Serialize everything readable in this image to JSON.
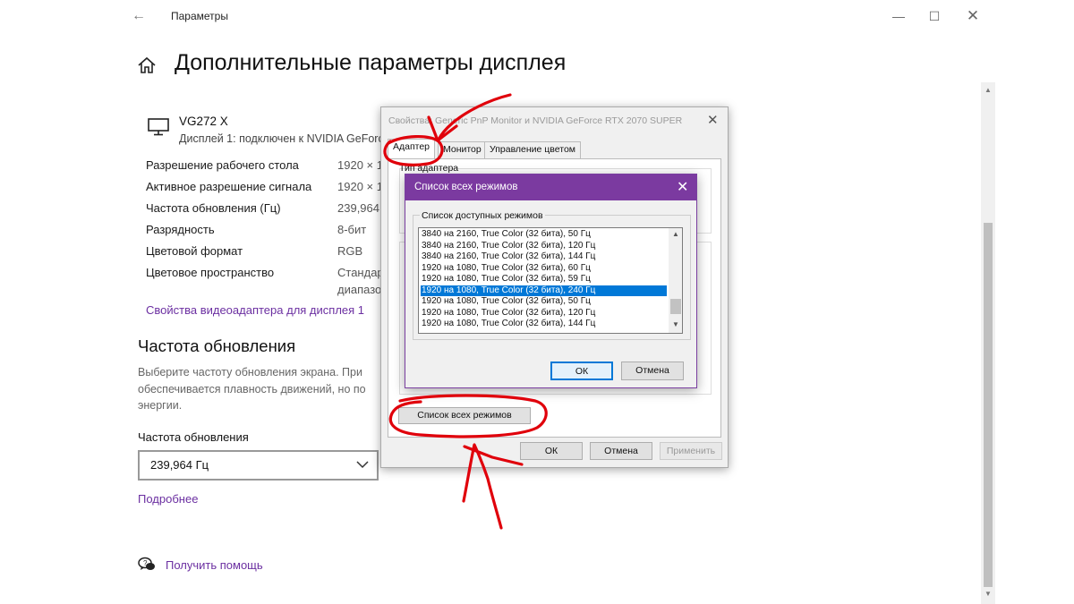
{
  "settings": {
    "window_title": "Параметры",
    "page_title": "Дополнительные параметры дисплея",
    "monitor": {
      "name": "VG272 X",
      "subtitle": "Дисплей 1: подключен к NVIDIA GeForce"
    },
    "info_rows": [
      {
        "label": "Разрешение рабочего стола",
        "value": "1920 × 1"
      },
      {
        "label": "Активное разрешение сигнала",
        "value": "1920 × 1"
      },
      {
        "label": "Частота обновления (Гц)",
        "value": "239,964"
      },
      {
        "label": "Разрядность",
        "value": "8-бит"
      },
      {
        "label": "Цветовой формат",
        "value": "RGB"
      },
      {
        "label": "Цветовое пространство",
        "value": "Стандар",
        "value2": "диапазо"
      }
    ],
    "adapter_link": "Свойства видеоадаптера для дисплея 1",
    "refresh_section_title": "Частота обновления",
    "refresh_desc_1": "Выберите частоту обновления экрана. При",
    "refresh_desc_2": "обеспечивается плавность движений, но по",
    "refresh_desc_3": "энергии.",
    "refresh_label": "Частота обновления",
    "refresh_value": "239,964 Гц",
    "more_link": "Подробнее",
    "help_link": "Получить помощь"
  },
  "properties_dialog": {
    "title": "Свойства: Generic PnP Monitor и NVIDIA GeForce RTX 2070 SUPER",
    "tabs": [
      "Адаптер",
      "Монитор",
      "Управление цветом"
    ],
    "adapter_type_label": "Тип адаптера",
    "all_modes_button": "Список всех режимов",
    "ok": "ОК",
    "cancel": "Отмена",
    "apply": "Применить"
  },
  "modes_dialog": {
    "title": "Список всех режимов",
    "group_label": "Список доступных режимов",
    "modes": [
      "3840 на 2160, True Color (32 бита), 50 Гц",
      "3840 на 2160, True Color (32 бита), 120 Гц",
      "3840 на 2160, True Color (32 бита), 144 Гц",
      "1920 на 1080, True Color (32 бита), 60 Гц",
      "1920 на 1080, True Color (32 бита), 59 Гц",
      "1920 на 1080, True Color (32 бита), 240 Гц",
      "1920 на 1080, True Color (32 бита), 50 Гц",
      "1920 на 1080, True Color (32 бита), 120 Гц",
      "1920 на 1080, True Color (32 бита), 144 Гц"
    ],
    "selected_index": 5,
    "ok": "ОК",
    "cancel": "Отмена"
  },
  "colors": {
    "accent_purple": "#7b3aa0",
    "link_purple": "#6b2fa1",
    "selection_blue": "#0078d7",
    "annotation_red": "#e0000b"
  }
}
